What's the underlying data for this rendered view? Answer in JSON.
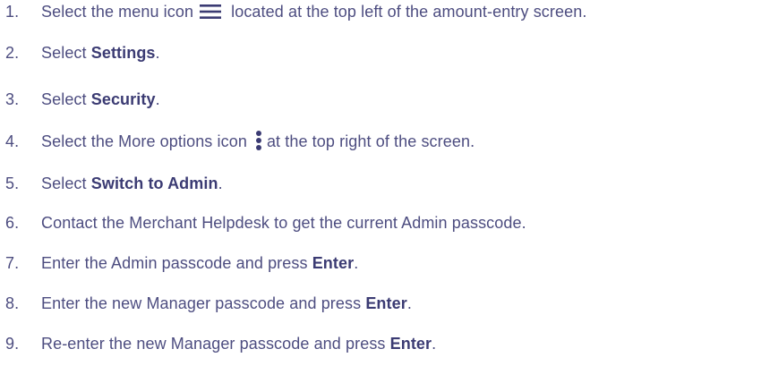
{
  "steps": [
    {
      "num": "1.",
      "pre": "Select the menu icon",
      "icon": "menu-icon",
      "post": "located at the top left of the amount-entry screen."
    },
    {
      "num": "2.",
      "pre": "Select ",
      "bold": "Settings",
      "post": "."
    },
    {
      "num": "3.",
      "pre": "Select ",
      "bold": "Security",
      "post": "."
    },
    {
      "num": "4.",
      "pre": "Select the More options icon",
      "icon": "more-options-icon",
      "post": "at the top right of the screen."
    },
    {
      "num": "5.",
      "pre": "Select ",
      "bold": "Switch to Admin",
      "post": "."
    },
    {
      "num": "6.",
      "text": "Contact the Merchant Helpdesk to get the current Admin passcode."
    },
    {
      "num": "7.",
      "pre": "Enter the Admin passcode and press ",
      "bold": "Enter",
      "post": "."
    },
    {
      "num": "8.",
      "pre": "Enter the new Manager passcode and press ",
      "bold": "Enter",
      "post": "."
    },
    {
      "num": "9.",
      "pre": "Re-enter the new Manager passcode and press ",
      "bold": "Enter",
      "post": "."
    }
  ],
  "colors": {
    "text": "#4d4d80",
    "icon": "#3b3b73"
  }
}
